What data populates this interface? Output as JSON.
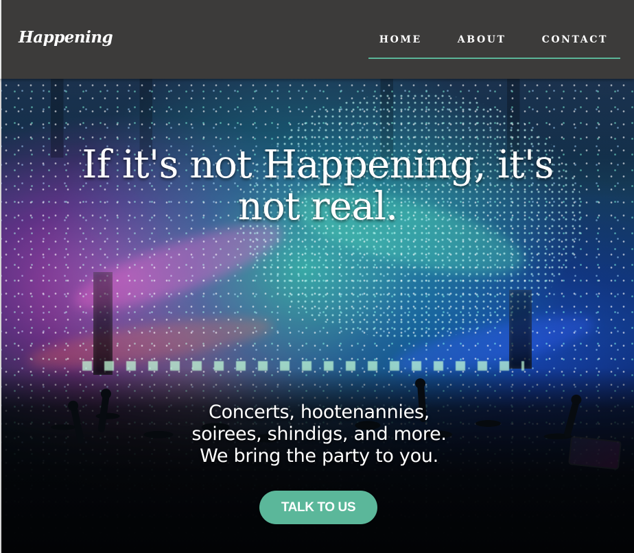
{
  "header": {
    "logo": "Happening",
    "nav": {
      "home": "HOME",
      "about": "ABOUT",
      "contact": "CONTACT"
    },
    "active_item": "HOME",
    "active_color": "#5bb79a"
  },
  "hero": {
    "headline": "If it's not Happening, it's not real.",
    "subtext_lines": [
      "Concerts, hootenannies,",
      "soirees, shindigs, and more.",
      "We bring the party to you."
    ],
    "cta_label": "TALK TO US"
  },
  "theme": {
    "nav_background": "#3c3b3a",
    "button_color": "#5bb79a",
    "text_color": "#ffffff"
  },
  "icons": {
    "hero_image": "concert-crowd-with-stage-lights"
  }
}
